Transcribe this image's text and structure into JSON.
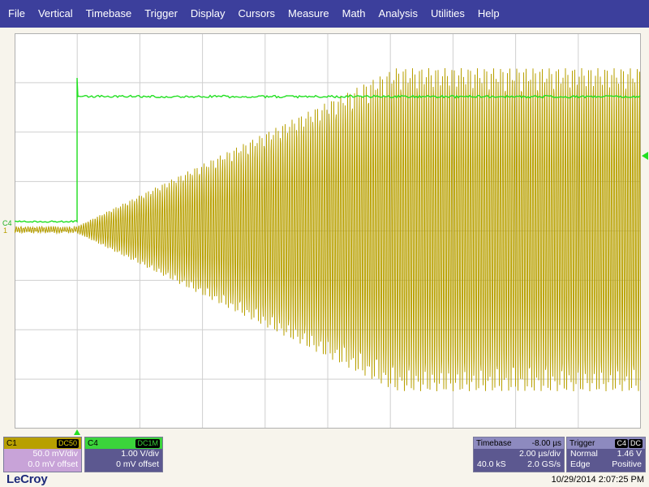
{
  "menu": [
    "File",
    "Vertical",
    "Timebase",
    "Trigger",
    "Display",
    "Cursors",
    "Measure",
    "Math",
    "Analysis",
    "Utilities",
    "Help"
  ],
  "colors": {
    "c1": "#b8a000",
    "c4": "#22e022",
    "grid": "#cfcfcf",
    "menu_bg": "#3c3f9c"
  },
  "display": {
    "h_divisions": 10,
    "v_divisions": 8,
    "trigger_marker_icon": "triangle-up-icon",
    "level_marker_icon": "triangle-left-icon"
  },
  "markers": {
    "c4_label": "C4",
    "c1_label": "1"
  },
  "c1": {
    "label": "C1",
    "coupling": "DC50",
    "vdiv": "50.0 mV/div",
    "offset": "0.0 mV offset"
  },
  "c4": {
    "label": "C4",
    "coupling": "DC1M",
    "vdiv": "1.00 V/div",
    "offset": "0 mV offset"
  },
  "timebase": {
    "label": "Timebase",
    "delay": "-8.00 µs",
    "tdiv": "2.00 µs/div",
    "samples": "40.0 kS",
    "rate": "2.0 GS/s"
  },
  "trigger": {
    "label": "Trigger",
    "source": "C4",
    "coupling": "DC",
    "mode": "Normal",
    "level": "1.46 V",
    "type": "Edge",
    "slope": "Positive"
  },
  "brand": "LeCroy",
  "timestamp": "10/29/2014 2:07:25 PM"
}
